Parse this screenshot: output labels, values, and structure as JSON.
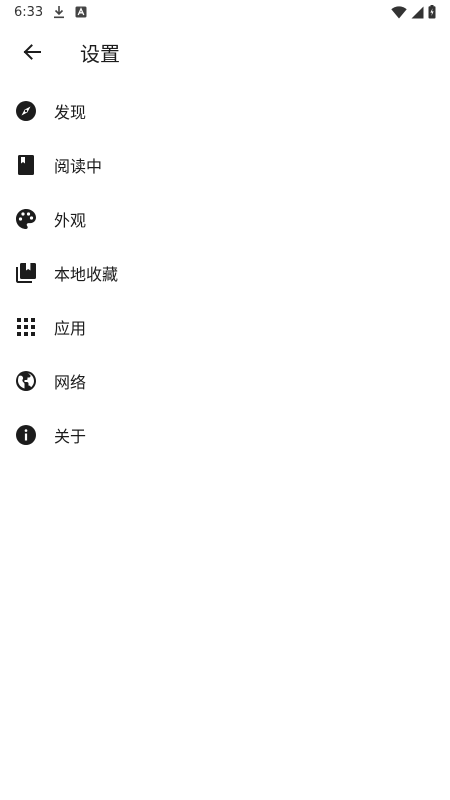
{
  "status_bar": {
    "time": "6:33",
    "icons": [
      "download-icon",
      "a-notification-icon",
      "wifi-icon",
      "signal-icon",
      "battery-charging-icon"
    ]
  },
  "app_bar": {
    "back_icon": "arrow-back-icon",
    "title": "设置"
  },
  "settings": {
    "items": [
      {
        "label": "发现",
        "icon": "compass-icon"
      },
      {
        "label": "阅读中",
        "icon": "book-icon"
      },
      {
        "label": "外观",
        "icon": "palette-icon"
      },
      {
        "label": "本地收藏",
        "icon": "collections-bookmark-icon"
      },
      {
        "label": "应用",
        "icon": "apps-grid-icon"
      },
      {
        "label": "网络",
        "icon": "globe-icon"
      },
      {
        "label": "关于",
        "icon": "info-icon"
      }
    ]
  },
  "colors": {
    "background": "#ffffff",
    "text": "#1c1c1c",
    "icon": "#1c1c1c"
  }
}
